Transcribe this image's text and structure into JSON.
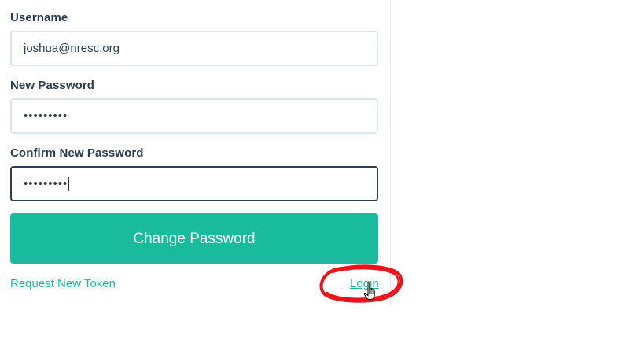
{
  "form": {
    "username": {
      "label": "Username",
      "value": "joshua@nresc.org"
    },
    "new_password": {
      "label": "New Password",
      "value": "•••••••••"
    },
    "confirm_password": {
      "label": "Confirm New Password",
      "value": "•••••••••"
    },
    "submit_label": "Change Password"
  },
  "links": {
    "request_token": "Request New Token",
    "login": "Login"
  },
  "colors": {
    "accent": "#18bc9c",
    "text": "#2c3e50",
    "input_border": "#dce4ec",
    "annotation": "#e8141b"
  },
  "icons": {
    "cursor": "hand-pointer-icon",
    "annotation": "red-circle-annotation"
  }
}
